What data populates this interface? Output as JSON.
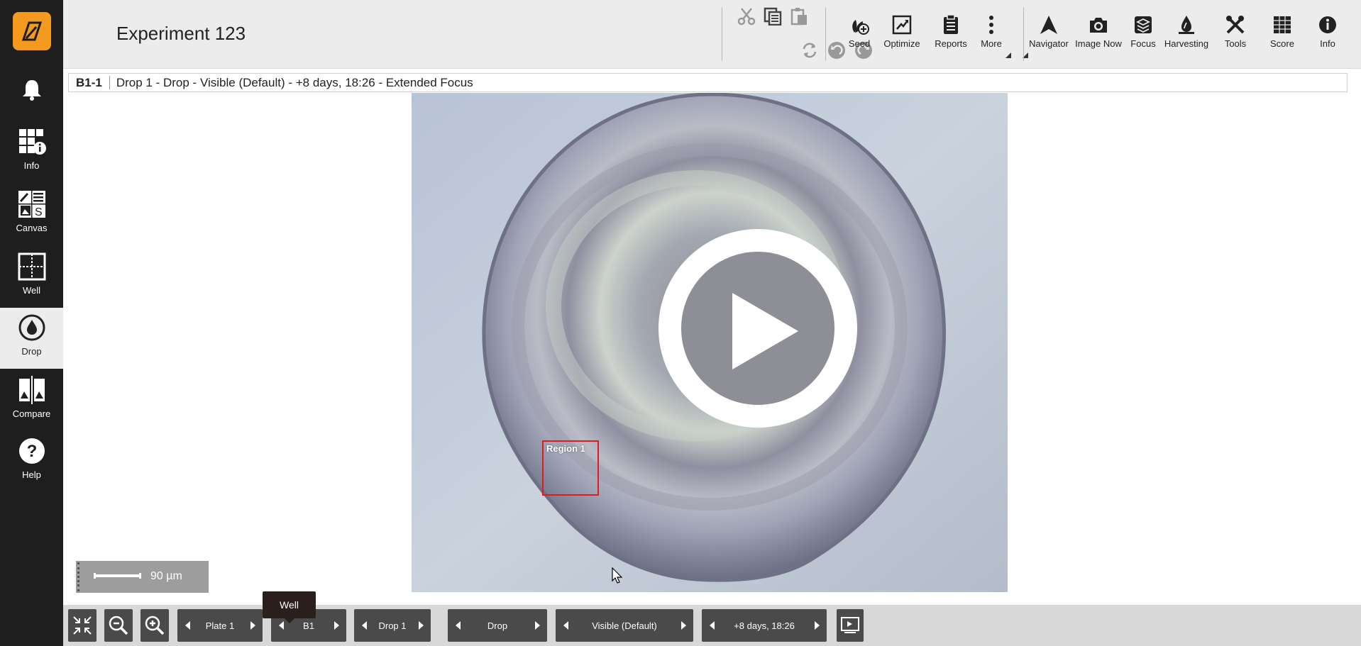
{
  "app": {
    "title": "Experiment 123"
  },
  "sidebar": {
    "items": [
      {
        "id": "notifications",
        "label": "",
        "icon": "bell-icon"
      },
      {
        "id": "info",
        "label": "Info",
        "icon": "grid-info-icon"
      },
      {
        "id": "canvas",
        "label": "Canvas",
        "icon": "canvas-icon"
      },
      {
        "id": "well",
        "label": "Well",
        "icon": "well-icon"
      },
      {
        "id": "drop",
        "label": "Drop",
        "icon": "drop-icon",
        "active": true
      },
      {
        "id": "compare",
        "label": "Compare",
        "icon": "compare-icon"
      },
      {
        "id": "help",
        "label": "Help",
        "icon": "help-icon"
      }
    ]
  },
  "toolbar": {
    "edit": [
      "cut-icon",
      "copy-icon",
      "paste-icon",
      "refresh-icon",
      "undo-icon",
      "redo-icon"
    ],
    "tools": [
      {
        "label": "Seed",
        "icon": "seed-icon"
      },
      {
        "label": "Optimize",
        "icon": "optimize-icon"
      },
      {
        "label": "Reports",
        "icon": "reports-icon"
      },
      {
        "label": "More",
        "icon": "more-icon"
      },
      {
        "label": "Navigator",
        "icon": "navigator-icon"
      },
      {
        "label": "Image Now",
        "icon": "camera-icon"
      },
      {
        "label": "Focus",
        "icon": "focus-icon"
      },
      {
        "label": "Harvesting",
        "icon": "harvesting-icon"
      },
      {
        "label": "Tools",
        "icon": "tools-icon"
      },
      {
        "label": "Score",
        "icon": "score-icon"
      },
      {
        "label": "Info",
        "icon": "info-icon"
      }
    ]
  },
  "infobar": {
    "well_id": "B1-1",
    "description": "Drop 1 - Drop - Visible (Default) - +8 days, 18:26 - Extended Focus"
  },
  "image": {
    "region_label": "Region 1"
  },
  "scalebar": {
    "text": "90 µm"
  },
  "bottom": {
    "plate": "Plate 1",
    "well": "B1",
    "drop": "Drop 1",
    "type": "Drop",
    "imaging": "Visible (Default)",
    "time": "+8 days, 18:26",
    "tooltip": "Well"
  },
  "colors": {
    "logo": "#f39a1f",
    "sidebar": "#1e1e1e",
    "region": "#e01b1b"
  }
}
